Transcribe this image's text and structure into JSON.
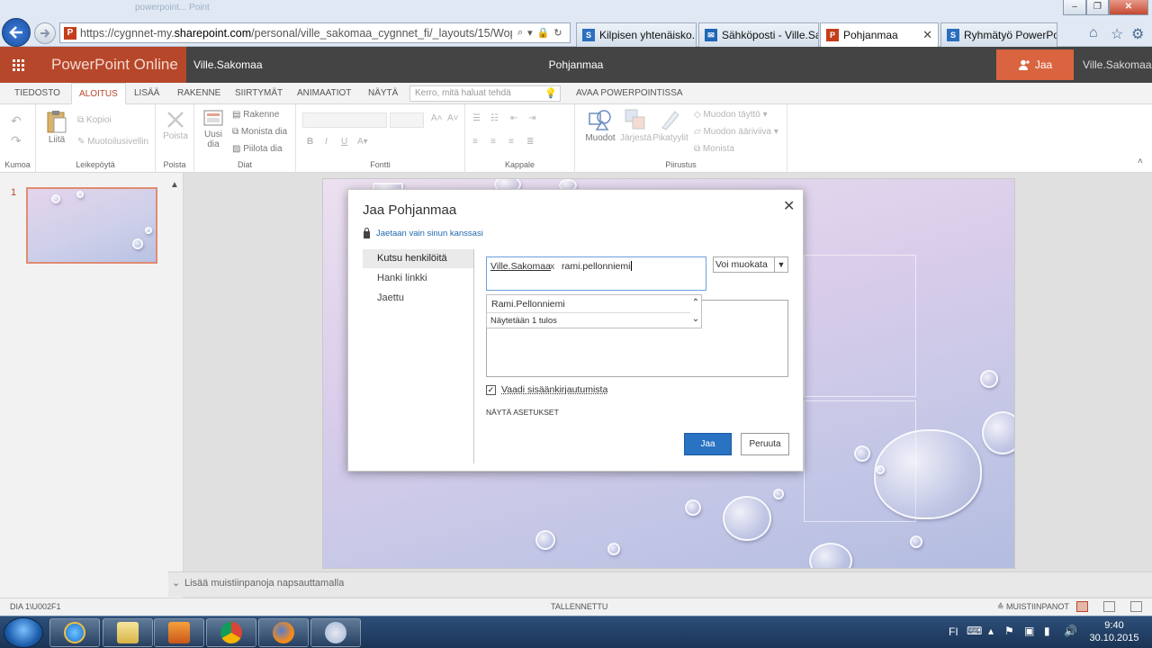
{
  "browser": {
    "ghost_title": "powerpoint... Point",
    "url_prefix": "https://cygnnet-my.",
    "url_domain": "sharepoint.com",
    "url_rest": "/personal/ville_sakomaa_cygnnet_fi/_layouts/15/WopiFrame",
    "tabs": [
      {
        "label": "Kilpisen yhtenäisko...",
        "icon": "sharepoint-icon",
        "color": "#2b6fbf"
      },
      {
        "label": "Sähköposti - Ville.Sa...",
        "icon": "mail-icon",
        "color": "#1f67b8"
      },
      {
        "label": "Pohjanmaa",
        "icon": "powerpoint-icon",
        "color": "#c43e1c",
        "active": true
      },
      {
        "label": "Ryhmätyö PowerPo...",
        "icon": "sharepoint-icon",
        "color": "#2b6fbf"
      }
    ]
  },
  "header": {
    "app_name": "PowerPoint Online",
    "user_crumb": "Ville.Sakomaa",
    "doc_title": "Pohjanmaa",
    "share_label": "Jaa",
    "user_name": "Ville.Sakomaa",
    "brand_color": "#b7472a"
  },
  "ribbon": {
    "tabs": [
      "TIEDOSTO",
      "ALOITUS",
      "LISÄÄ",
      "RAKENNE",
      "SIIRTYMÄT",
      "ANIMAATIOT",
      "NÄYTÄ"
    ],
    "active_tab": "ALOITUS",
    "tell_me_placeholder": "Kerro, mitä haluat tehdä",
    "open_in_app": "AVAA POWERPOINTISSA",
    "groups": {
      "undo": {
        "label": "Kumoa"
      },
      "clipboard": {
        "label": "Leikepöytä",
        "paste": "Liitä",
        "copy": "Kopioi",
        "format_painter": "Muotoilusivellin"
      },
      "delete": {
        "label": "Poista",
        "delete": "Poista"
      },
      "slides": {
        "label": "Diat",
        "new_slide_1": "Uusi",
        "new_slide_2": "dia",
        "layout": "Rakenne",
        "duplicate": "Monista dia",
        "hide": "Piilota dia"
      },
      "font": {
        "label": "Fontti"
      },
      "paragraph": {
        "label": "Kappale"
      },
      "drawing": {
        "label": "Piirustus",
        "shapes": "Muodot",
        "arrange": "Järjestä",
        "quick_styles": "Pikatyylit",
        "fill": "Muodon täyttö",
        "outline": "Muodon ääriviiva",
        "duplicate": "Monista"
      }
    }
  },
  "slides_panel": {
    "slide_number": "1"
  },
  "notes": {
    "placeholder": "Lisää muistiinpanoja napsauttamalla"
  },
  "status": {
    "slide_info": "DIA 1\\U002F1",
    "saved": "TALLENNETTU",
    "notes_label": "MUISTIINPANOT"
  },
  "dialog": {
    "title": "Jaa Pohjanmaa",
    "privacy_note": "Jaetaan vain sinun kanssasi",
    "menu": [
      "Kutsu henkilöitä",
      "Hanki linkki",
      "Jaettu"
    ],
    "active_menu": "Kutsu henkilöitä",
    "recipient_token": "Ville.Sakomaa",
    "token_remove": "x",
    "typed_text": "rami.pellonniemi",
    "permission": "Voi muokata",
    "suggestion": "Rami.Pellonniemi",
    "results_count": "Näytetään 1 tulos",
    "require_signin": "Vaadi sisäänkirjautumista",
    "require_signin_checked": true,
    "show_settings": "NÄYTÄ ASETUKSET",
    "share_button": "Jaa",
    "cancel_button": "Peruuta"
  },
  "taskbar": {
    "language": "FI",
    "time": "9:40",
    "date": "30.10.2015"
  }
}
